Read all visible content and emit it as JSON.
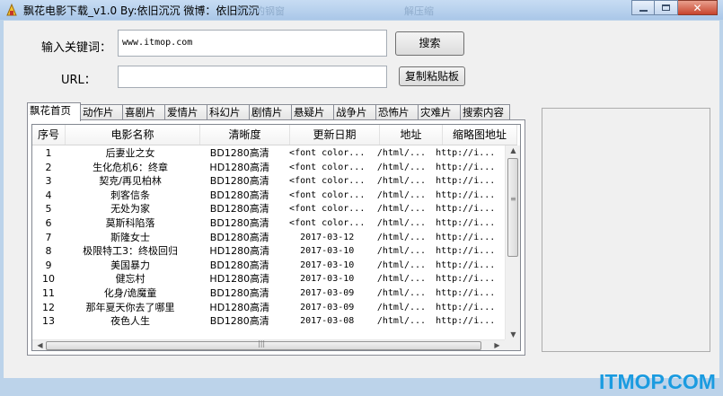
{
  "window": {
    "title": "飘花电影下载_v1.0  By:依旧沉沉  微博：依旧沉沉",
    "background_hint_1": "集中的钢窗",
    "background_hint_2": "解压缩",
    "min_icon": "minimize-icon",
    "max_icon": "maximize-icon",
    "close_icon": "close-icon"
  },
  "search": {
    "keyword_label": "输入关键词：",
    "keyword_value": "www.itmop.com",
    "search_button": "搜索",
    "url_label": "URL：",
    "url_value": "",
    "copy_button": "复制粘贴板"
  },
  "tabs": [
    "飘花首页",
    "动作片",
    "喜剧片",
    "爱情片",
    "科幻片",
    "剧情片",
    "悬疑片",
    "战争片",
    "恐怖片",
    "灾难片",
    "搜索内容"
  ],
  "table": {
    "columns": [
      "序号",
      "电影名称",
      "清晰度",
      "更新日期",
      "地址",
      "缩略图地址"
    ],
    "rows": [
      [
        "1",
        "后妻业之女",
        "BD1280高清",
        "<font color...",
        "/html/...",
        "http://i..."
      ],
      [
        "2",
        "生化危机6：终章",
        "HD1280高清",
        "<font color...",
        "/html/...",
        "http://i..."
      ],
      [
        "3",
        "契克/再见柏林",
        "BD1280高清",
        "<font color...",
        "/html/...",
        "http://i..."
      ],
      [
        "4",
        "刺客信条",
        "BD1280高清",
        "<font color...",
        "/html/...",
        "http://i..."
      ],
      [
        "5",
        "无处为家",
        "BD1280高清",
        "<font color...",
        "/html/...",
        "http://i..."
      ],
      [
        "6",
        "莫斯科陷落",
        "BD1280高清",
        "<font color...",
        "/html/...",
        "http://i..."
      ],
      [
        "7",
        "斯隆女士",
        "BD1280高清",
        "2017-03-12",
        "/html/...",
        "http://i..."
      ],
      [
        "8",
        "极限特工3：终极回归",
        "HD1280高清",
        "2017-03-10",
        "/html/...",
        "http://i..."
      ],
      [
        "9",
        "美国暴力",
        "BD1280高清",
        "2017-03-10",
        "/html/...",
        "http://i..."
      ],
      [
        "10",
        "健忘村",
        "HD1280高清",
        "2017-03-10",
        "/html/...",
        "http://i..."
      ],
      [
        "11",
        "化身/诡魔童",
        "BD1280高清",
        "2017-03-09",
        "/html/...",
        "http://i..."
      ],
      [
        "12",
        "那年夏天你去了哪里",
        "HD1280高清",
        "2017-03-09",
        "/html/...",
        "http://i..."
      ],
      [
        "13",
        "夜色人生",
        "BD1280高清",
        "2017-03-08",
        "/html/...",
        "http://i..."
      ]
    ]
  },
  "watermark": {
    "text": "ITMOP.COM",
    "color": "#1a9be0"
  },
  "colors": {
    "titlebar": "#bcd3ea",
    "client": "#f0f0f0",
    "close": "#c7442d"
  }
}
